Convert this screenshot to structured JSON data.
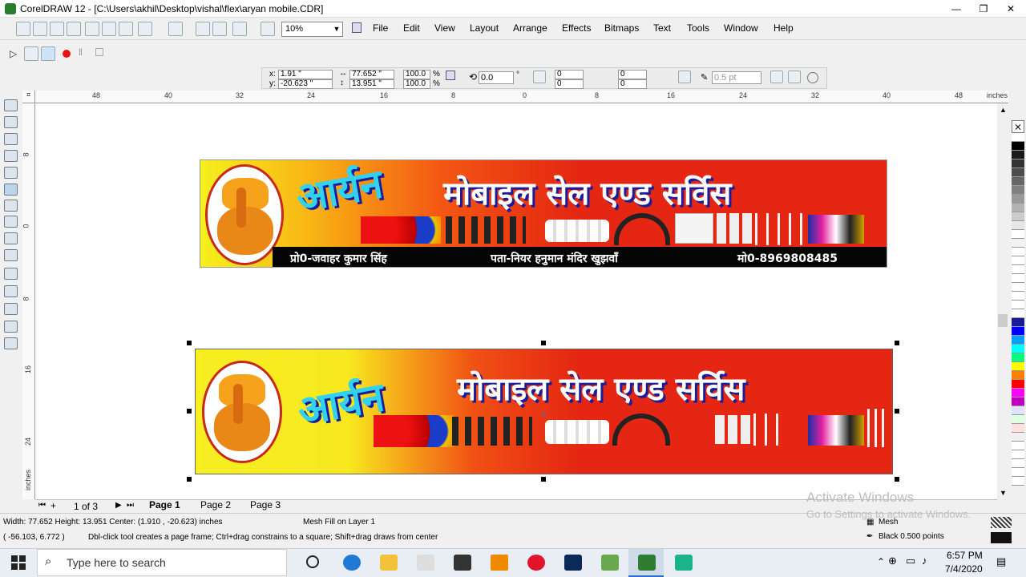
{
  "window": {
    "title": "CorelDRAW 12 - [C:\\Users\\akhil\\Desktop\\vishal\\flex\\aryan mobile.CDR]",
    "controls": [
      "—",
      "❐",
      "✕"
    ]
  },
  "zoom": "10%",
  "menu": [
    "File",
    "Edit",
    "View",
    "Layout",
    "Arrange",
    "Effects",
    "Bitmaps",
    "Text",
    "Tools",
    "Window",
    "Help"
  ],
  "properties": {
    "x": "1.91 \"",
    "y": "-20.623 \"",
    "width": "77.652 \"",
    "height": "13.951 \"",
    "scale_x": "100.0",
    "scale_y": "100.0",
    "rotation": "0.0",
    "degree": "°",
    "percent": "%",
    "x_label": "x:",
    "y_label": "y:",
    "corner": [
      "0",
      "0",
      "0",
      "0"
    ],
    "outline": "0.5 pt"
  },
  "ruler": {
    "units": "inches",
    "h_ticks": [
      "48",
      "40",
      "32",
      "24",
      "16",
      "8",
      "0",
      "8",
      "16",
      "24",
      "32",
      "40",
      "48"
    ],
    "v_ticks": [
      "8",
      "0",
      "8",
      "16",
      "24"
    ]
  },
  "banner1": {
    "title_left": "आर्यन",
    "title_right": "मोबाइल सेल एण्ड सर्विस",
    "prop": "प्रो0-जवाहर कुमार सिंह",
    "address": "पता-नियर हनुमान मंदिर खुझवाँ",
    "phone": "मो0-8969808485"
  },
  "banner2": {
    "title_left": "आर्यन",
    "title_right": "मोबाइल सेल एण्ड सर्विस"
  },
  "pages": {
    "counter": "1 of 3",
    "tabs": [
      "Page 1",
      "Page 2",
      "Page 3"
    ]
  },
  "status": {
    "dimensions": "Width: 77.652  Height: 13.951  Center: (1.910 , -20.623)  inches",
    "object": "Mesh Fill on Layer 1",
    "fill": "Mesh",
    "cursor": "( -56.103, 6.772 )",
    "hint": "Dbl-click tool creates a page frame; Ctrl+drag constrains to a square; Shift+drag draws from center",
    "outline": "Black  0.500 points"
  },
  "watermark": {
    "line1": "Activate Windows",
    "line2": "Go to Settings to activate Windows."
  },
  "taskbar": {
    "search_placeholder": "Type here to search",
    "time": "6:57 PM",
    "date": "7/4/2020"
  },
  "colors": {
    "banner_red": "#e42612",
    "banner_yellow": "#f7ef22",
    "title_blue": "#1c1c9a",
    "palette": [
      "#ffffff",
      "#000000",
      "#1a1a1a",
      "#333333",
      "#4d4d4d",
      "#666666",
      "#808080",
      "#999999",
      "#b3b3b3",
      "#cccccc",
      "#e6e6e6",
      "#ffffff",
      "#f2f2f2",
      "#ffffff",
      "#ffffff",
      "#ffffff",
      "#ffffff",
      "#ffffff",
      "#ffffff",
      "#ffffff",
      "#ffffff",
      "#1a1a9a",
      "#0000ff",
      "#00a0ff",
      "#00ffff",
      "#00ff80",
      "#ffff00",
      "#ff8000",
      "#ff0000",
      "#ff00ff",
      "#c000c0",
      "#e0e0ff",
      "#e0ffe0",
      "#ffe0e0",
      "#f0f0f0",
      "#ffffff",
      "#ffffff",
      "#ffffff",
      "#ffffff",
      "#ffffff"
    ]
  }
}
